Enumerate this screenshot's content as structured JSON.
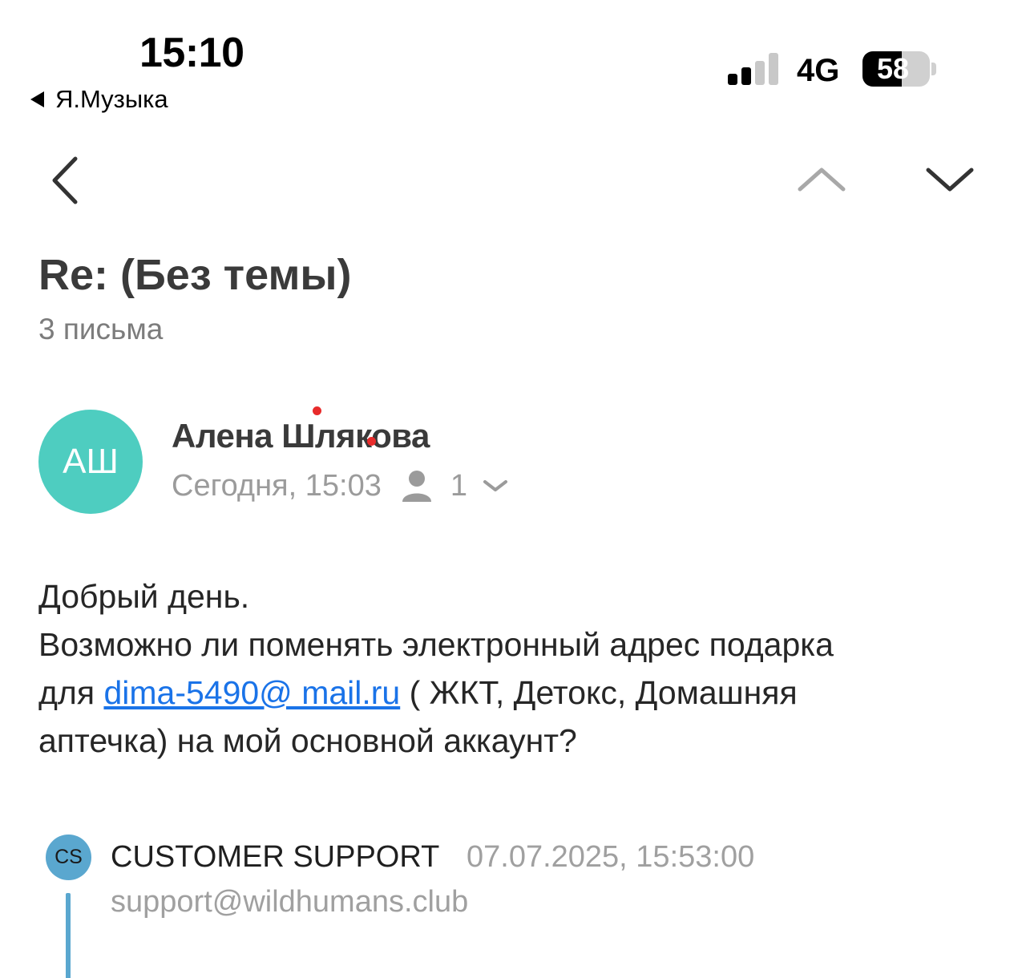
{
  "status_bar": {
    "time": "15:10",
    "back_app": "Я.Музыка",
    "network": "4G",
    "battery": "58",
    "battery_level": 0.58,
    "signal_bars_active": 2,
    "signal_bars_total": 4
  },
  "nav": {
    "back_icon": "chevron-left-icon",
    "prev_icon": "chevron-up-icon",
    "next_icon": "chevron-down-icon"
  },
  "thread": {
    "subject": "Re: (Без темы)",
    "count": "3 письма"
  },
  "message": {
    "avatar_initials": "АШ",
    "avatar_color": "#4ecdc0",
    "sender": "Алена Шлякова",
    "date": "Сегодня, 15:03",
    "recipients_count": "1",
    "body": {
      "line1": "Добрый день.",
      "line2": "Возможно ли поменять электронный адрес подарка",
      "pre_link": "для ",
      "link": "dima-5490@ mail.ru",
      "post_link": " ( ЖКТ, Детокс, Домашняя",
      "line4": "аптечка) на мой основной аккаунт?"
    }
  },
  "quoted": {
    "avatar_initials": "CS",
    "avatar_color": "#5aa7cf",
    "sender": "CUSTOMER SUPPORT",
    "date": "07.07.2025, 15:53:00",
    "email": "support@wildhumans.club"
  }
}
